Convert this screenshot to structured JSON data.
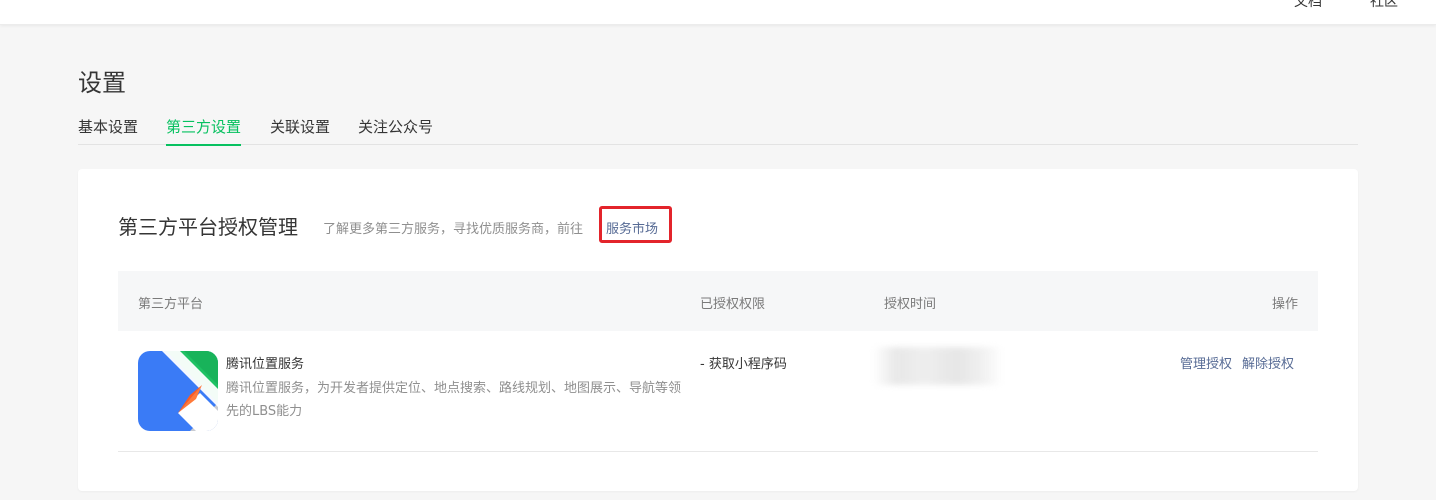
{
  "topbar": {
    "link_left": "文档",
    "link_right": "社区"
  },
  "page": {
    "title": "设置"
  },
  "tabs": [
    {
      "label": "基本设置",
      "active": false
    },
    {
      "label": "第三方设置",
      "active": true
    },
    {
      "label": "关联设置",
      "active": false
    },
    {
      "label": "关注公众号",
      "active": false
    }
  ],
  "section": {
    "title": "第三方平台授权管理",
    "description": "了解更多第三方服务，寻找优质服务商，前往",
    "market_link": "服务市场"
  },
  "table": {
    "headers": [
      "第三方平台",
      "已授权权限",
      "授权时间",
      "操作"
    ],
    "rows": [
      {
        "icon": "tencent-location-service-icon",
        "name": "腾讯位置服务",
        "description": "腾讯位置服务，为开发者提供定位、地点搜索、路线规划、地图展示、导航等领先的LBS能力",
        "permission": "- 获取小程序码",
        "auth_time": "",
        "actions": [
          "管理授权",
          "解除授权"
        ]
      }
    ]
  },
  "colors": {
    "accent": "#07c160",
    "link": "#576b95",
    "highlight": "#e3242b"
  }
}
